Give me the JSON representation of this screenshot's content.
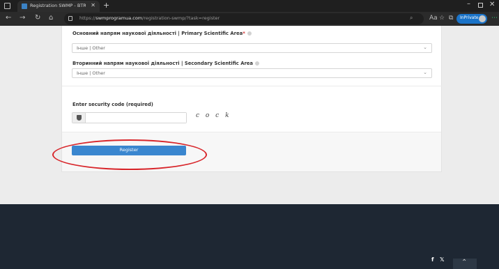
{
  "browser": {
    "tab_title": "Registration SWMP - BTRP Ukrai",
    "url_domain": "swmprogramua.com",
    "url_path": "/registration-swmp/?task=register",
    "url_prefix": "https://",
    "inprivate_label": "InPrivate"
  },
  "form": {
    "primary_area_label": "Основний напрям наукової діяльності | Primary Scientific Area",
    "primary_area_value": "Інше | Other",
    "secondary_area_label": "Вторинний напрям наукової діяльності | Secondary Scientific Area",
    "secondary_area_value": "Інше | Other",
    "security_label": "Enter security code (required)",
    "security_value": "",
    "captcha_text": "c o c k",
    "register_label": "Register"
  },
  "footer": {
    "social": [
      "f",
      "𝕏"
    ]
  },
  "colors": {
    "accent": "#3a86cf",
    "annotation": "#d8262b",
    "footer_bg": "#1e2733"
  }
}
